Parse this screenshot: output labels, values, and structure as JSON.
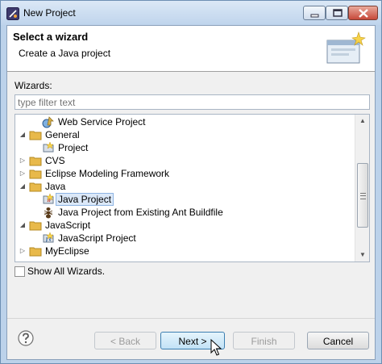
{
  "window": {
    "title": "New Project",
    "controls": [
      "minimize-icon",
      "maximize-icon",
      "close-icon"
    ]
  },
  "header": {
    "title": "Select a wizard",
    "description": "Create a Java project",
    "banner_icon": "new-wizard-banner-icon"
  },
  "wizards": {
    "label": "Wizards:",
    "filter_placeholder": "type filter text",
    "filter_value": ""
  },
  "tree": {
    "items": [
      {
        "label": "Web Service Project",
        "depth": 1,
        "arrow": "",
        "icon": "web-service-icon"
      },
      {
        "label": "General",
        "depth": 0,
        "arrow": "expanded",
        "icon": "folder-icon"
      },
      {
        "label": "Project",
        "depth": 1,
        "arrow": "",
        "icon": "project-icon"
      },
      {
        "label": "CVS",
        "depth": 0,
        "arrow": "collapsed",
        "icon": "folder-icon"
      },
      {
        "label": "Eclipse Modeling Framework",
        "depth": 0,
        "arrow": "collapsed",
        "icon": "folder-icon"
      },
      {
        "label": "Java",
        "depth": 0,
        "arrow": "expanded",
        "icon": "folder-icon"
      },
      {
        "label": "Java Project",
        "depth": 1,
        "arrow": "",
        "icon": "java-project-icon",
        "selected": true
      },
      {
        "label": "Java Project from Existing Ant Buildfile",
        "depth": 1,
        "arrow": "",
        "icon": "ant-buildfile-icon"
      },
      {
        "label": "JavaScript",
        "depth": 0,
        "arrow": "expanded",
        "icon": "folder-icon"
      },
      {
        "label": "JavaScript Project",
        "depth": 1,
        "arrow": "",
        "icon": "javascript-project-icon"
      },
      {
        "label": "MyEclipse",
        "depth": 0,
        "arrow": "collapsed",
        "icon": "folder-icon"
      }
    ]
  },
  "show_all": {
    "label": "Show All Wizards.",
    "checked": false
  },
  "buttons": {
    "back": "< Back",
    "next": "Next >",
    "finish": "Finish",
    "cancel": "Cancel"
  },
  "colors": {
    "folder": "#e8b94a",
    "selection_bg": "#dbe8f8",
    "selection_border": "#8eb4e3",
    "default_button_border": "#3c7fb1"
  }
}
